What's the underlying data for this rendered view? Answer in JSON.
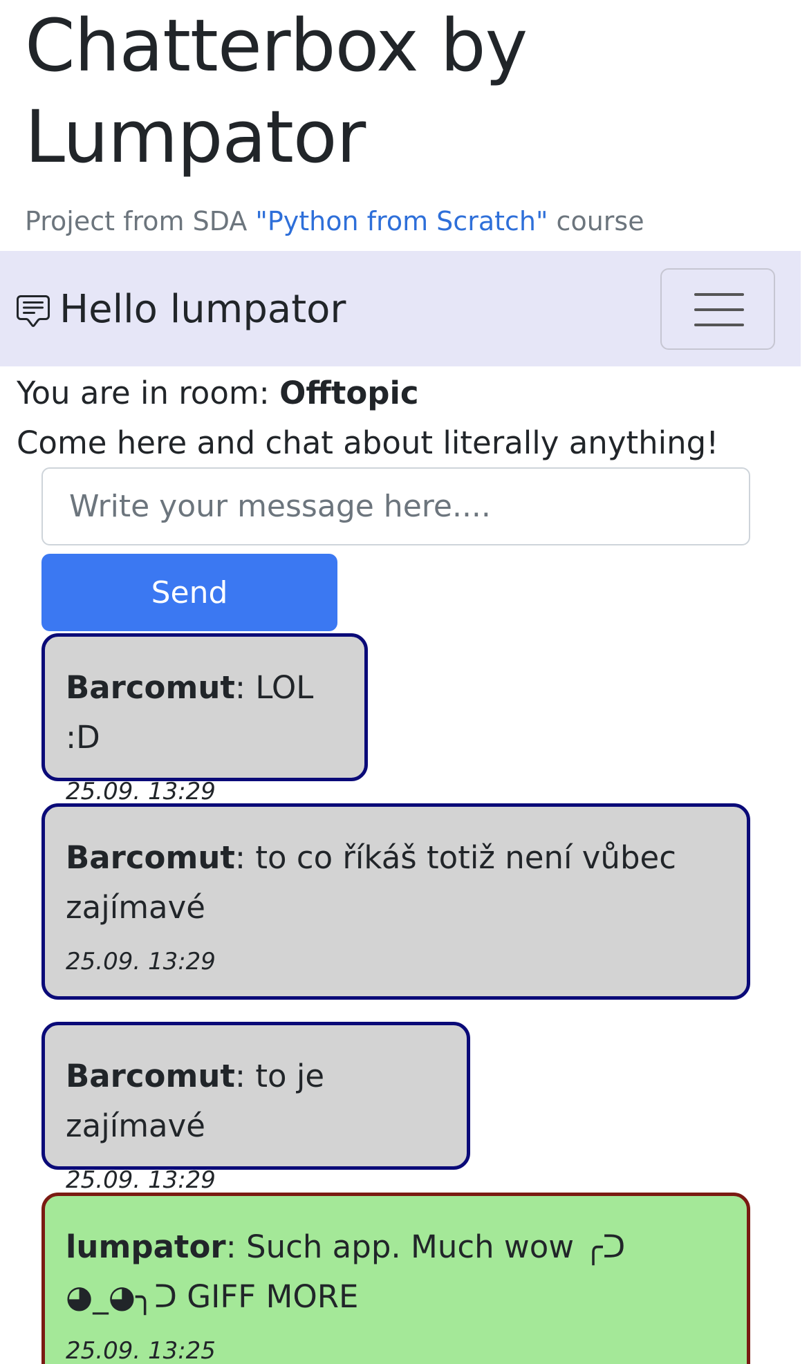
{
  "header": {
    "title": "Chatterbox by Lumpator",
    "subtitle_prefix": "Project from SDA ",
    "subtitle_link": "\"Python from Scratch\"",
    "subtitle_suffix": " course"
  },
  "navbar": {
    "brand_icon": "chat-square-text-icon",
    "greeting": "Hello lumpator",
    "toggler_icon": "hamburger-menu-icon",
    "background": "#e6e6f7"
  },
  "room": {
    "label": "You are in room: ",
    "name": "Offtopic",
    "description": "Come here and chat about literally anything!"
  },
  "composer": {
    "placeholder": "Write your message here....",
    "value": "",
    "send_label": "Send",
    "send_color": "#3b78f2"
  },
  "messages": [
    {
      "author": "Barcomut",
      "separator": ": ",
      "text": "LOL :D",
      "time": "25.09. 13:29",
      "own": false
    },
    {
      "author": "Barcomut",
      "separator": ": ",
      "text": "to co říkáš totiž není vůbec zajímavé",
      "time": "25.09. 13:29",
      "own": false
    },
    {
      "author": "Barcomut",
      "separator": ": ",
      "text": "to je zajímavé",
      "time": "25.09. 13:29",
      "own": false
    },
    {
      "author": "lumpator",
      "separator": ": ",
      "text": "Such app. Much wow ╭ᑐ ◕_◕╮ᑐ GIFF MORE",
      "time": "25.09. 13:25",
      "own": true
    }
  ],
  "colors": {
    "other_bubble": "#d3d3d3",
    "other_border": "#0a0a78",
    "own_bubble": "#a4e898",
    "own_border": "#7a1a12",
    "link": "#2e6fd9"
  }
}
